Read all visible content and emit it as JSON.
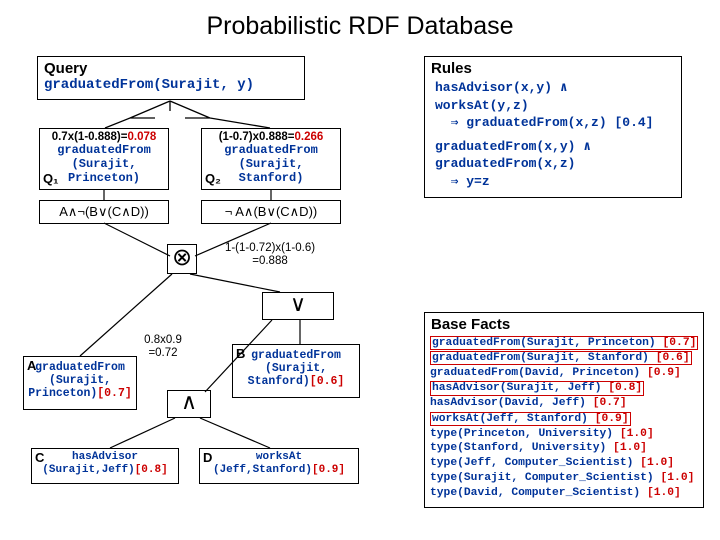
{
  "title": "Probabilistic RDF Database",
  "query": {
    "header": "Query",
    "text": "graduatedFrom(Surajit, y)"
  },
  "rules": {
    "header": "Rules",
    "r1a": "hasAdvisor(x,y) ∧",
    "r1b": "worksAt(y,z)",
    "r1c": "⇒ graduatedFrom(x,z) [0.4]",
    "r2a": "graduatedFrom(x,y) ∧",
    "r2b": "graduatedFrom(x,z)",
    "r2c": "⇒ y=z"
  },
  "facts": {
    "header": "Base Facts",
    "rows": [
      {
        "t": "graduatedFrom(Surajit, Princeton)",
        "p": "[0.7]",
        "hl": true
      },
      {
        "t": "graduatedFrom(Surajit, Stanford)",
        "p": "[0.6]",
        "hl": true
      },
      {
        "t": "graduatedFrom(David, Princeton)",
        "p": "[0.9]",
        "hl": false
      },
      {
        "t": "hasAdvisor(Surajit, Jeff)",
        "p": "[0.8]",
        "hl": true
      },
      {
        "t": "hasAdvisor(David, Jeff)",
        "p": "[0.7]",
        "hl": false
      },
      {
        "t": "worksAt(Jeff, Stanford)",
        "p": "[0.9]",
        "hl": true
      },
      {
        "t": "type(Princeton, University)",
        "p": "[1.0]",
        "hl": false
      },
      {
        "t": "type(Stanford, University)",
        "p": "[1.0]",
        "hl": false
      },
      {
        "t": "type(Jeff, Computer_Scientist)",
        "p": "[1.0]",
        "hl": false
      },
      {
        "t": "type(Surajit, Computer_Scientist)",
        "p": "[1.0]",
        "hl": false
      },
      {
        "t": "type(David, Computer_Scientist)",
        "p": "[1.0]",
        "hl": false
      }
    ]
  },
  "nodes": {
    "q1_calc": "0.7x(1-0.888)=0.078",
    "q1_pred": "graduatedFrom\n(Surajit,\nPrinceton)",
    "q1_tag": "Q₁",
    "q2_calc": "(1-0.7)x0.888=0.266",
    "q2_pred": "graduatedFrom\n(Surajit,\nStanford)",
    "q2_tag": "Q₂",
    "f1": "A∧¬(B∨(C∧D))",
    "f2": "¬ A∧(B∨(C∧D))",
    "a_pred": "graduatedFrom\n(Surajit,\nPrinceton)[0.7]",
    "a_tag": "A",
    "b_pred": "graduatedFrom\n(Surajit,\nStanford)[0.6]",
    "b_tag": "B",
    "c_pred": "hasAdvisor\n(Surajit,Jeff)[0.8]",
    "c_tag": "C",
    "d_pred": "worksAt\n(Jeff,Stanford)[0.9]",
    "d_tag": "D",
    "calc_or": "1-(1-0.72)x(1-0.6)\n=0.888",
    "calc_and": "0.8x0.9\n=0.72"
  },
  "ops": {
    "tensor": "⊗",
    "or": "∨",
    "and": "∧"
  }
}
